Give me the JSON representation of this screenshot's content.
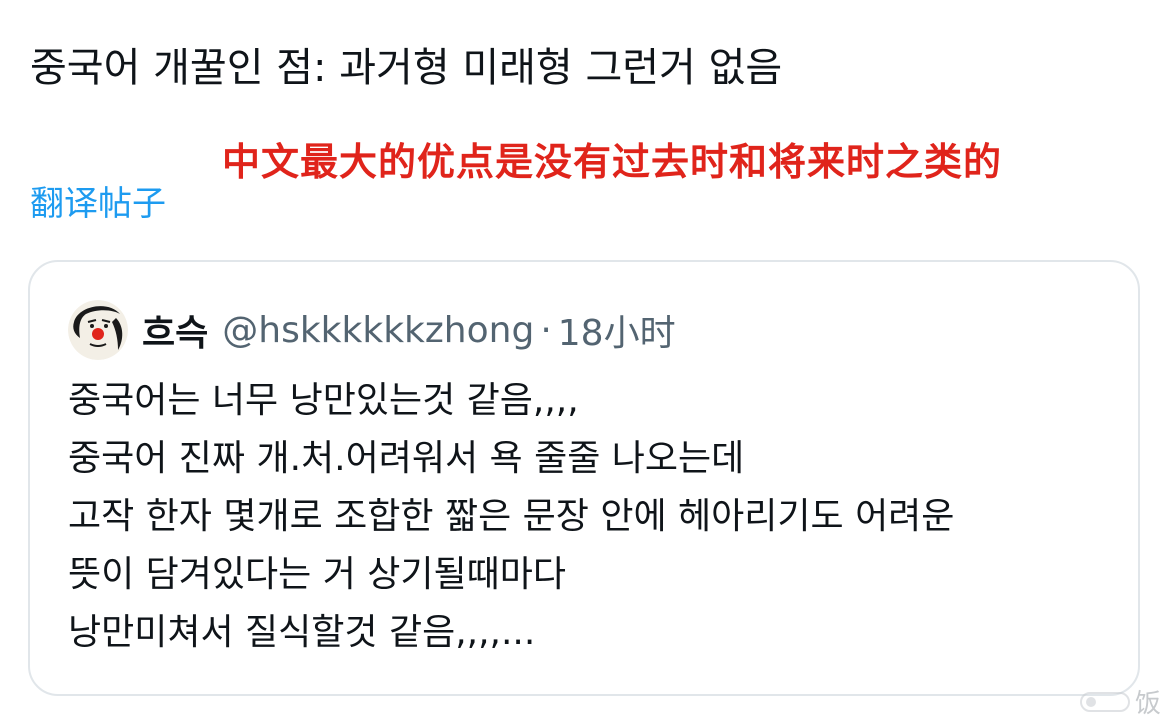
{
  "tweet": {
    "text": "중국어 개꿀인 점: 과거형 미래형 그런거 없음",
    "translate_label": "翻译帖子"
  },
  "annotation": {
    "text": "中文最大的优点是没有过去时和将来时之类的",
    "color": "#e0241b"
  },
  "quote": {
    "display_name": "흐슥",
    "handle": "@hskkkkkkzhong",
    "separator": "·",
    "timestamp": "18小时",
    "lines": [
      "중국어는 너무 낭만있는것 같음,,,,",
      "중국어 진짜 개.처.어려워서 욕 줄줄 나오는데",
      "고작 한자 몇개로 조합한 짧은 문장 안에 헤아리기도 어려운",
      "뜻이 담겨있다는 거 상기될때마다",
      "낭만미쳐서 질식할것 같음,,,,..."
    ]
  },
  "watermark": {
    "text": "饭"
  },
  "colors": {
    "link": "#1d9bf0",
    "text_primary": "#0f1419",
    "text_secondary": "#536471",
    "border": "#e1e6ea"
  }
}
